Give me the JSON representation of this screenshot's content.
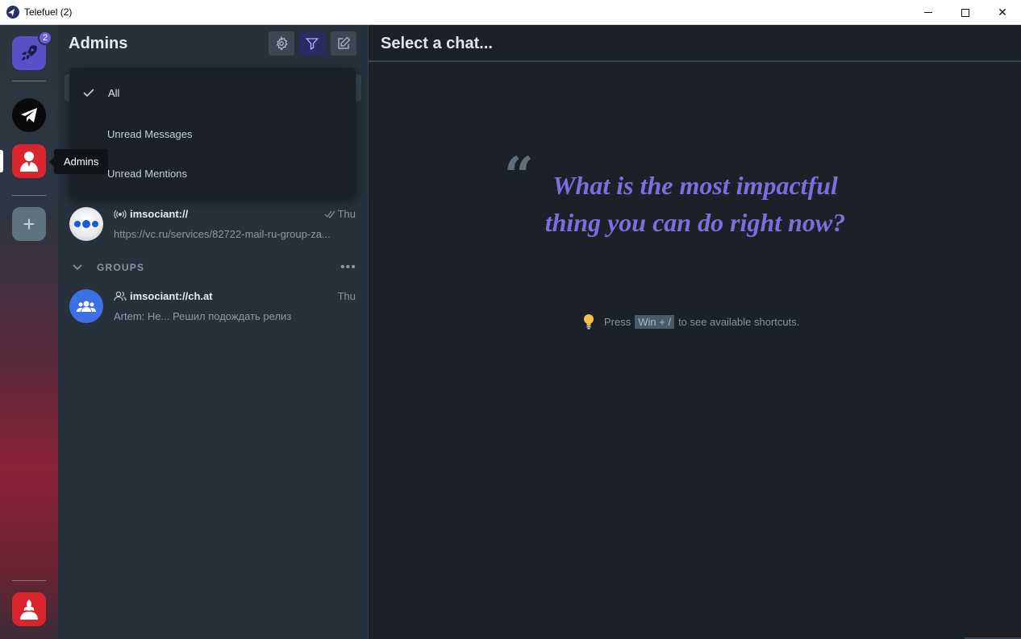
{
  "window": {
    "title": "Telefuel (2)",
    "controls": {
      "minimize": "",
      "maximize": "",
      "close": "✕"
    }
  },
  "rail": {
    "badge_count": "2",
    "tooltip": "Admins",
    "add_label": "+",
    "accounts": [
      {
        "name": "rocket",
        "color": "#5b4fc7"
      },
      {
        "name": "telegram",
        "color": "#0a0a0a"
      },
      {
        "name": "admins",
        "color": "#d9252e"
      },
      {
        "name": "bottom-account",
        "color": "#d9252e"
      }
    ]
  },
  "list": {
    "title": "Admins",
    "filter_menu": {
      "items": [
        {
          "label": "All",
          "checked": true
        },
        {
          "label": "Unread Messages",
          "checked": false
        },
        {
          "label": "Unread Mentions",
          "checked": false
        }
      ]
    },
    "channel_chat": {
      "name": "imsociant://",
      "time": "Thu",
      "preview": "https://vc.ru/services/82722-mail-ru-group-za..."
    },
    "groups_section": {
      "label": "GROUPS",
      "more": "•••"
    },
    "group_chat": {
      "name": "imsociant://ch.at",
      "time": "Thu",
      "sender": "Artem:",
      "preview": "Не... Решил подождать релиз"
    }
  },
  "main": {
    "title": "Select a chat...",
    "quote_mark": "“",
    "quote": "What is the most impactful thing you can do right now?",
    "hint": {
      "before": "Press",
      "shortcut": "Win + /",
      "after": "to see available shortcuts."
    },
    "accent_color": "#7b6fe0"
  }
}
